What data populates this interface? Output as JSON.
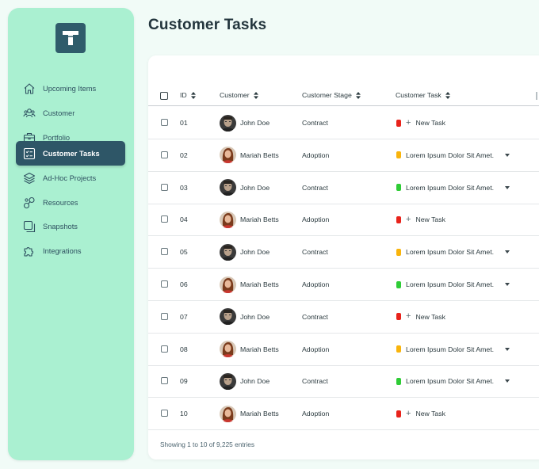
{
  "page": {
    "title": "Customer Tasks"
  },
  "sidebar": {
    "logo_icon": "t-logo-icon",
    "items": [
      {
        "label": "Upcoming Items",
        "icon": "home-icon",
        "active": false
      },
      {
        "label": "Customer",
        "icon": "users-icon",
        "active": false
      },
      {
        "label": "Portfolio",
        "icon": "briefcase-icon",
        "active": false
      },
      {
        "label": "Customer Tasks",
        "icon": "checklist-icon",
        "active": true
      },
      {
        "label": "Ad-Hoc Projects",
        "icon": "layers-icon",
        "active": false
      },
      {
        "label": "Resources",
        "icon": "nodes-icon",
        "active": false
      },
      {
        "label": "Snapshots",
        "icon": "copy-icon",
        "active": false
      },
      {
        "label": "Integrations",
        "icon": "puzzle-icon",
        "active": false
      }
    ]
  },
  "table": {
    "headers": {
      "id": "ID",
      "customer": "Customer",
      "stage": "Customer Stage",
      "task": "Customer Task"
    },
    "rows": [
      {
        "id": "01",
        "customer": "John Doe",
        "avatar": "male",
        "stage": "Contract",
        "task": "New Task",
        "status": "red",
        "new": true
      },
      {
        "id": "02",
        "customer": "Mariah Betts",
        "avatar": "female",
        "stage": "Adoption",
        "task": "Lorem Ipsum Dolor Sit Amet.",
        "status": "yellow",
        "new": false
      },
      {
        "id": "03",
        "customer": "John Doe",
        "avatar": "male",
        "stage": "Contract",
        "task": "Lorem Ipsum Dolor Sit Amet.",
        "status": "green",
        "new": false
      },
      {
        "id": "04",
        "customer": "Mariah Betts",
        "avatar": "female",
        "stage": "Adoption",
        "task": "New Task",
        "status": "red",
        "new": true
      },
      {
        "id": "05",
        "customer": "John Doe",
        "avatar": "male",
        "stage": "Contract",
        "task": "Lorem Ipsum Dolor Sit Amet.",
        "status": "yellow",
        "new": false
      },
      {
        "id": "06",
        "customer": "Mariah Betts",
        "avatar": "female",
        "stage": "Adoption",
        "task": "Lorem Ipsum Dolor Sit Amet.",
        "status": "green",
        "new": false
      },
      {
        "id": "07",
        "customer": "John Doe",
        "avatar": "male",
        "stage": "Contract",
        "task": "New Task",
        "status": "red",
        "new": true
      },
      {
        "id": "08",
        "customer": "Mariah Betts",
        "avatar": "female",
        "stage": "Adoption",
        "task": "Lorem Ipsum Dolor Sit Amet.",
        "status": "yellow",
        "new": false
      },
      {
        "id": "09",
        "customer": "John Doe",
        "avatar": "male",
        "stage": "Contract",
        "task": "Lorem Ipsum Dolor Sit Amet.",
        "status": "green",
        "new": false
      },
      {
        "id": "10",
        "customer": "Mariah Betts",
        "avatar": "female",
        "stage": "Adoption",
        "task": "New Task",
        "status": "red",
        "new": true
      }
    ],
    "footer": "Showing 1 to 10 of 9,225 entries"
  },
  "colors": {
    "red": "#e8231b",
    "yellow": "#f9b40c",
    "green": "#2fcc36",
    "sidebar_bg": "#aaf0d1",
    "active_bg": "#2e5667"
  }
}
